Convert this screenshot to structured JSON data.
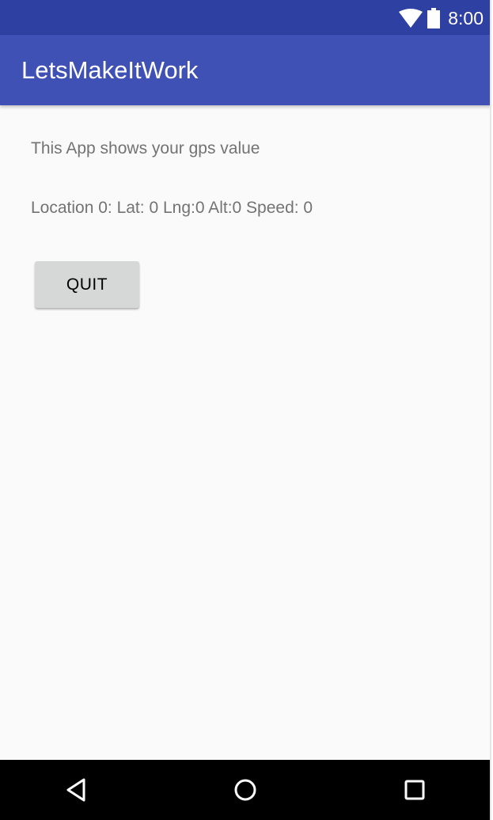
{
  "status_bar": {
    "time": "8:00",
    "icons": [
      "wifi-icon",
      "battery-icon"
    ],
    "background_color": "#2f40a3"
  },
  "app_bar": {
    "title": "LetsMakeItWork",
    "background_color": "#3f51b5"
  },
  "content": {
    "description": "This App shows your gps value",
    "location_text": "Location 0: Lat: 0 Lng:0 Alt:0 Speed: 0",
    "quit_label": "QUIT"
  },
  "nav_bar": {
    "icons": [
      "back-icon",
      "home-icon",
      "recents-icon"
    ]
  }
}
